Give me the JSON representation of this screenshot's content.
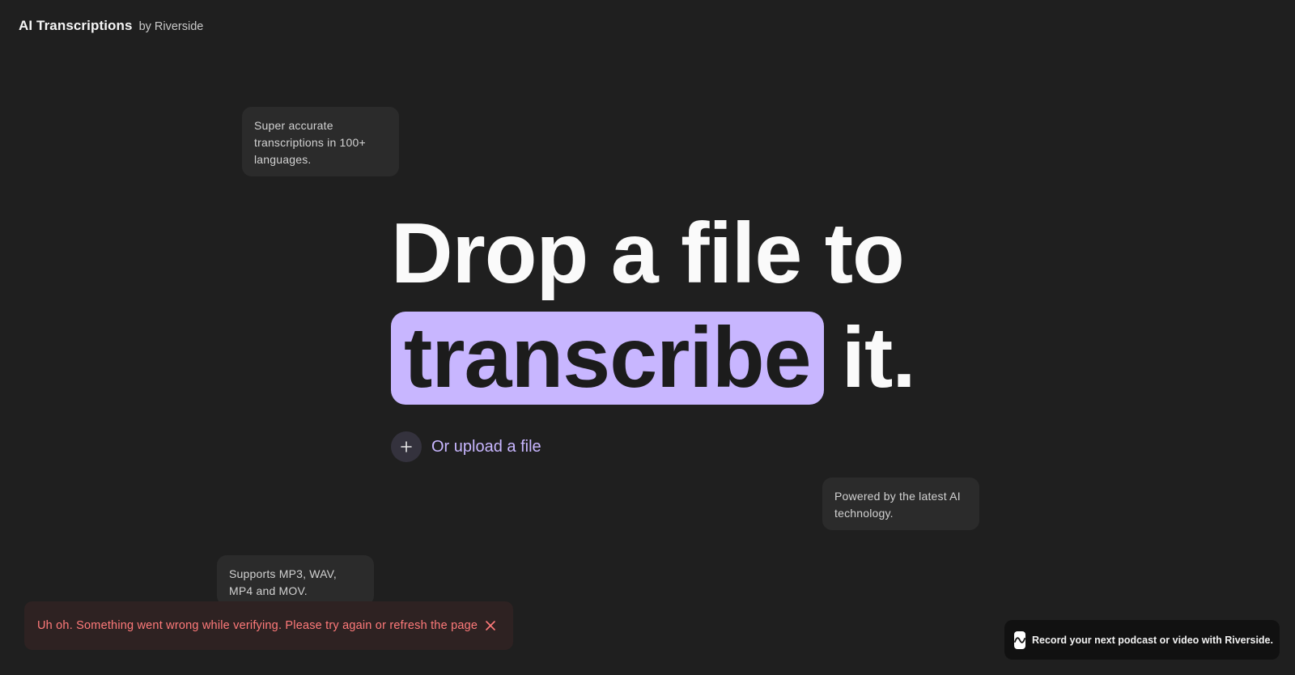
{
  "header": {
    "title": "AI Transcriptions",
    "by": "by Riverside"
  },
  "cards": {
    "languages": "Super accurate transcriptions in 100+ languages.",
    "powered": "Powered by the latest AI technology.",
    "formats": "Supports MP3, WAV, MP4 and MOV."
  },
  "hero": {
    "line1": "Drop a file to",
    "highlight": "transcribe",
    "tail": "it."
  },
  "upload": {
    "icon": "plus-icon",
    "label": "Or upload a file"
  },
  "toast": {
    "message": "Uh oh. Something went wrong while verifying. Please try again or refresh the page",
    "close_icon": "close-icon"
  },
  "promo": {
    "icon": "waveform-icon",
    "text": "Record your next podcast or video with Riverside."
  },
  "colors": {
    "background": "#1f1f1f",
    "accent": "#c8b6ff",
    "error": "#ff7a7a",
    "card": "#2b2b2b"
  }
}
